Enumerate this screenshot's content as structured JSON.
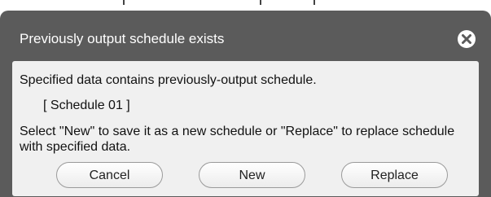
{
  "dialog": {
    "title": "Previously output schedule exists",
    "message": "Specified data contains previously-output schedule.",
    "schedule_name": "[ Schedule 01 ]",
    "instruction": "Select \"New\" to save it as a new schedule or \"Replace\" to replace schedule with specified data.",
    "buttons": {
      "cancel": "Cancel",
      "new": "New",
      "replace": "Replace"
    },
    "close_icon": "close-circle-icon"
  },
  "colors": {
    "dialog_background": "#5b5b5b",
    "body_background": "#f0f0f0",
    "title_text": "#ffffff"
  }
}
